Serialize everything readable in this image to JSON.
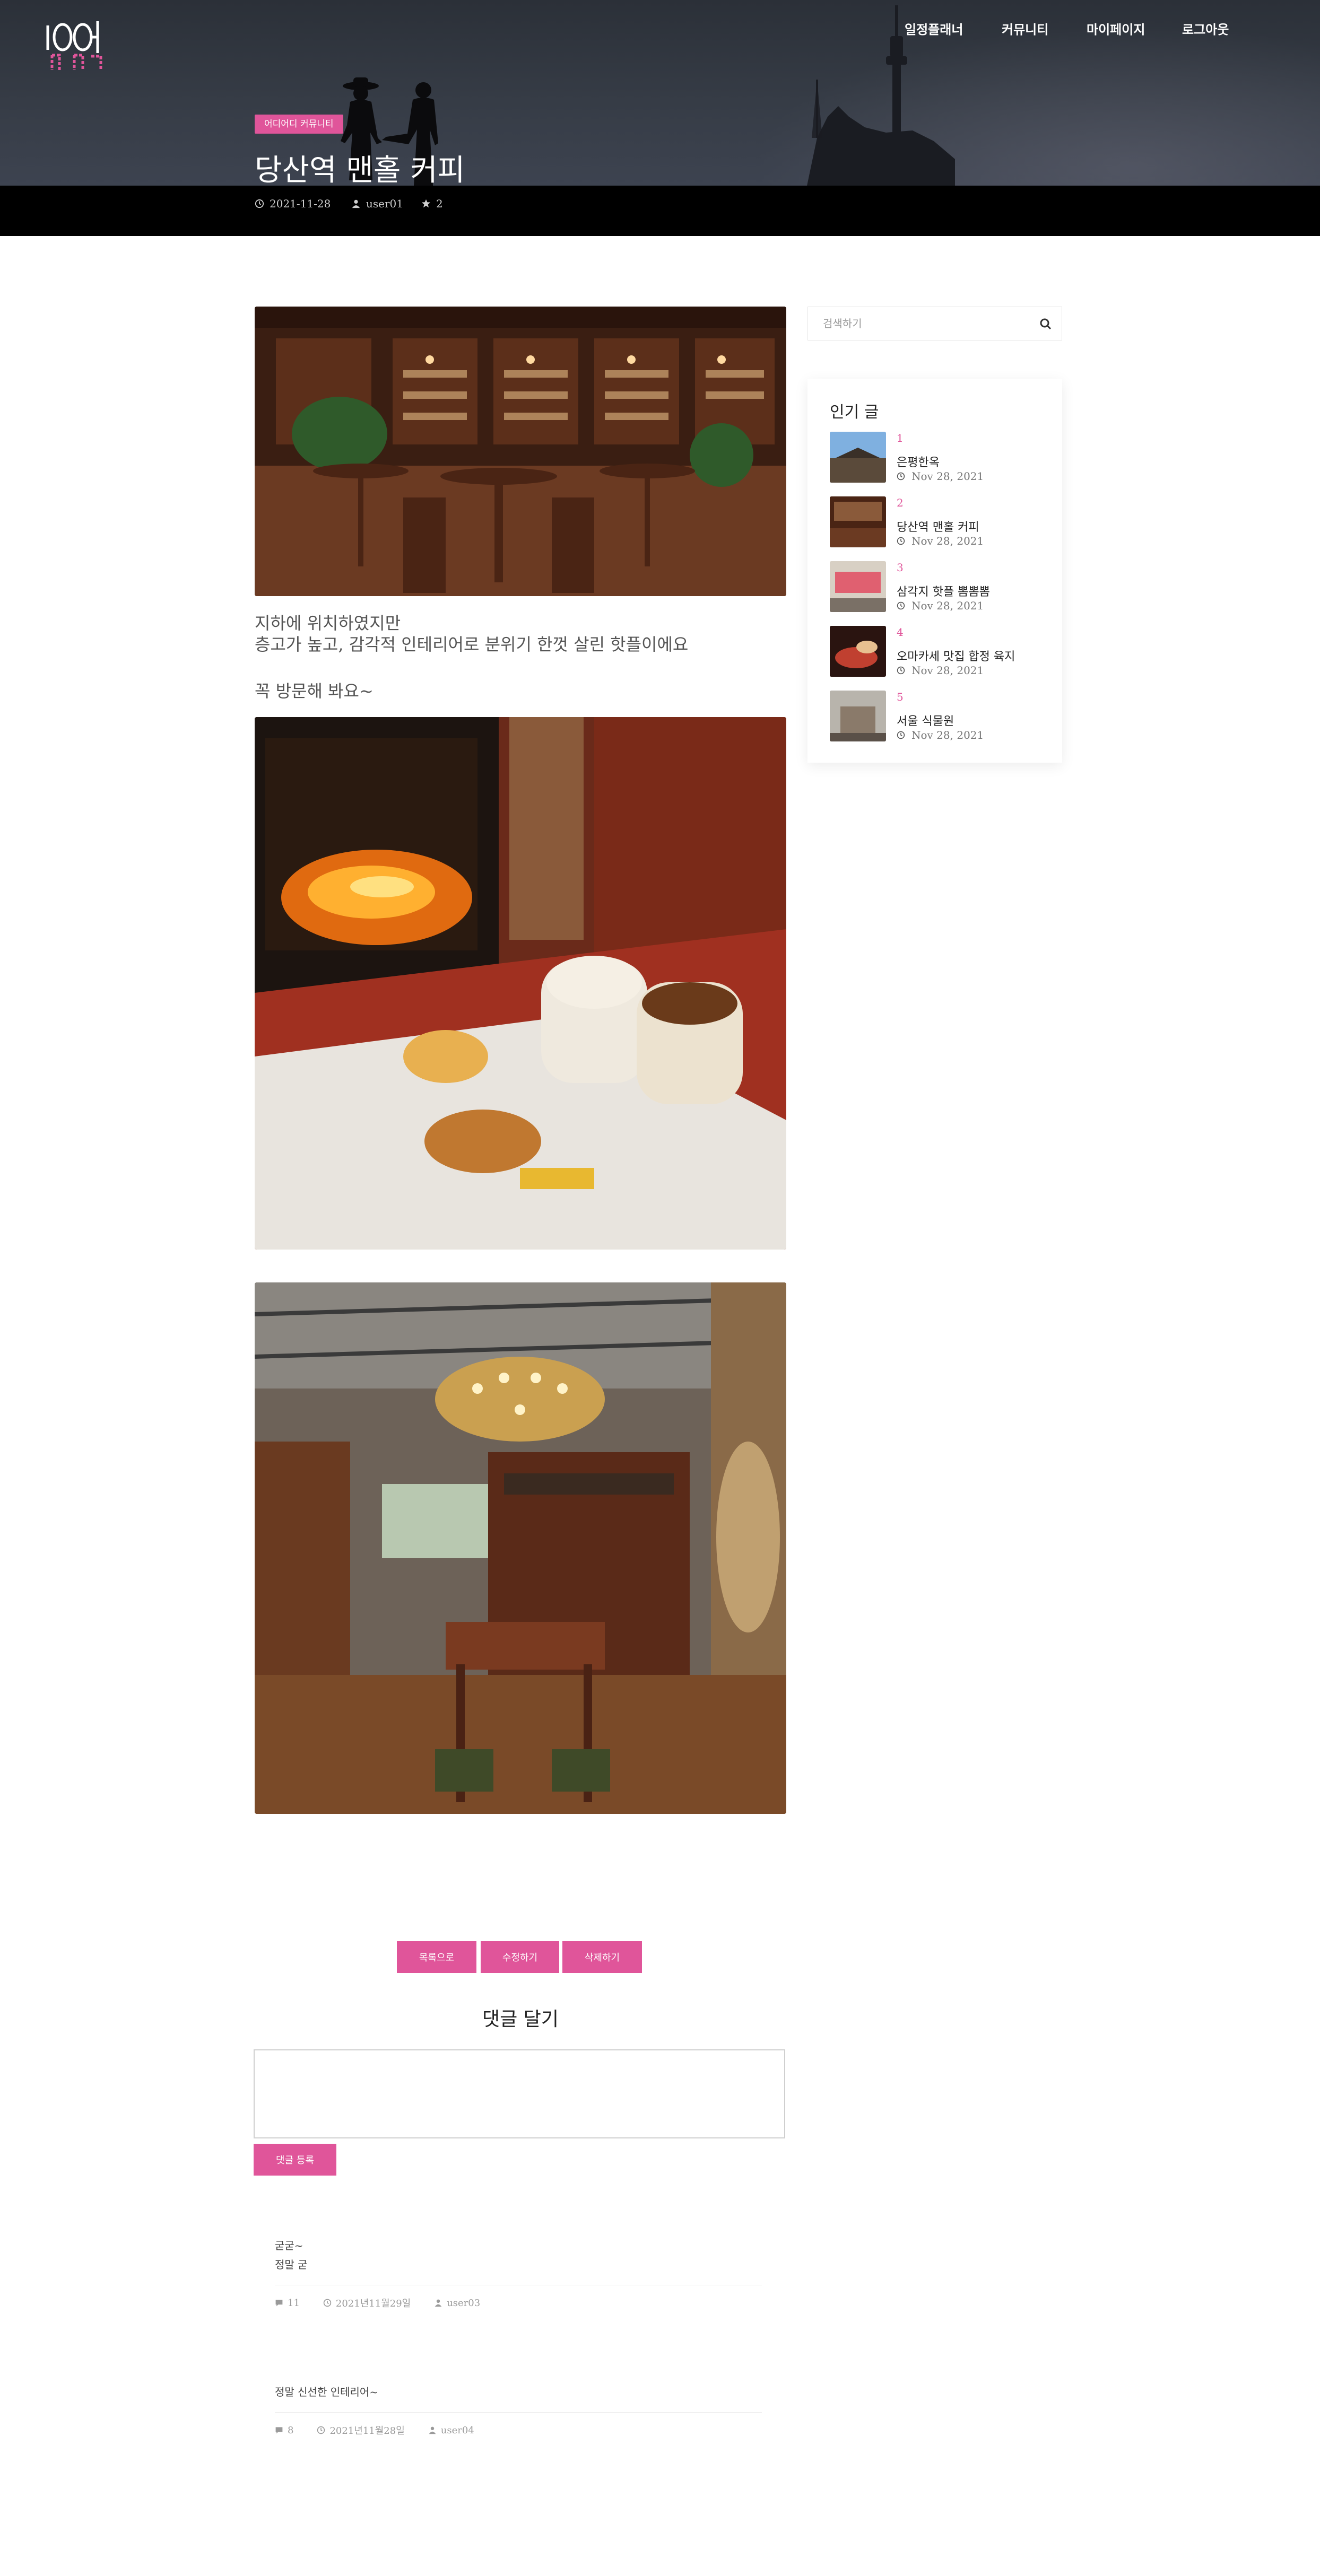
{
  "header": {
    "logo_text": "어디어디",
    "nav": [
      "일정플래너",
      "커뮤니티",
      "마이페이지",
      "로그아웃"
    ]
  },
  "post": {
    "category": "어디어디 커뮤니티",
    "title": "당산역 맨홀 커피",
    "date": "2021-11-28",
    "author": "user01",
    "likes": "2",
    "body": [
      "지하에 위치하였지만",
      "층고가 높고, 감각적 인테리어로 분위기 한껏 살린 핫플이에요",
      "꼭 방문해 봐요~"
    ]
  },
  "sidebar": {
    "search_placeholder": "검색하기",
    "popular_title": "인기 글",
    "popular": [
      {
        "rank": "1",
        "title": "은평한옥",
        "date": "Nov 28, 2021"
      },
      {
        "rank": "2",
        "title": "당산역 맨홀 커피",
        "date": "Nov 28, 2021"
      },
      {
        "rank": "3",
        "title": "삼각지 핫플 뽐뽐뽐",
        "date": "Nov 28, 2021"
      },
      {
        "rank": "4",
        "title": "오마카세 맛집 합정 육지",
        "date": "Nov 28, 2021"
      },
      {
        "rank": "5",
        "title": "서울 식물원",
        "date": "Nov 28, 2021"
      }
    ]
  },
  "actions": {
    "list": "목록으로",
    "edit": "수정하기",
    "delete": "삭제하기"
  },
  "comments_section": {
    "heading": "댓글 달기",
    "submit": "댓글 등록",
    "items": [
      {
        "lines": [
          "굳굳~",
          "정말 굳"
        ],
        "count": "11",
        "date": "2021년11월29일",
        "author": "user03"
      },
      {
        "lines": [
          "정말 신선한 인테리어~"
        ],
        "count": "8",
        "date": "2021년11월28일",
        "author": "user04"
      }
    ]
  },
  "colors": {
    "accent": "#e0559a",
    "hero_bg": "#2b3038",
    "meta_bar": "#000000"
  }
}
